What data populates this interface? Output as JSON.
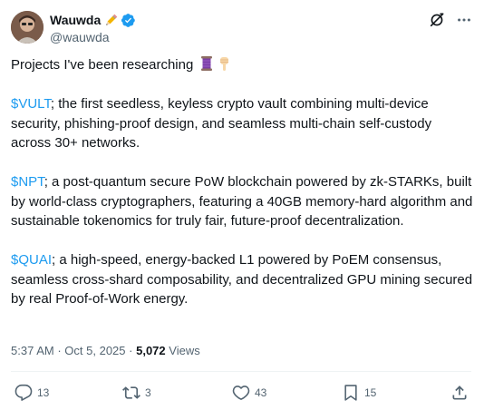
{
  "author": {
    "display_name": "Wauwda",
    "handle": "@wauwda"
  },
  "tweet": {
    "intro": "Projects I've been researching",
    "paragraphs": [
      {
        "cashtag": "$VULT",
        "text": "; the first seedless, keyless crypto vault combining multi-device security, phishing-proof design, and seamless multi-chain self-custody across 30+ networks."
      },
      {
        "cashtag": "$NPT",
        "text": "; a post-quantum secure PoW blockchain powered by zk-STARKs, built by world-class cryptographers, featuring a 40GB memory-hard algorithm and sustainable tokenomics for truly fair, future-proof decentralization."
      },
      {
        "cashtag": "$QUAI",
        "text": "; a high-speed, energy-backed L1 powered by PoEM consensus, seamless cross-shard composability, and decentralized GPU mining secured by real Proof-of-Work energy."
      }
    ]
  },
  "meta": {
    "time": "5:37 AM",
    "separator": "·",
    "date": "Oct 5, 2025",
    "views_count": "5,072",
    "views_label": "Views"
  },
  "actions": {
    "replies": "13",
    "reposts": "3",
    "likes": "43",
    "bookmarks": "15"
  },
  "icons": {
    "name_emoji": "pencil-emoji",
    "verified": "verified-badge-icon",
    "grok": "grok-icon",
    "more": "more-dots-icon",
    "intro_emoji_1": "thread-spool-emoji",
    "intro_emoji_2": "pointing-down-emoji",
    "reply": "reply-icon",
    "repost": "repost-icon",
    "like": "heart-icon",
    "bookmark": "bookmark-icon",
    "share": "share-icon"
  },
  "colors": {
    "text": "#0f1419",
    "secondary": "#536471",
    "accent": "#1d9bf0",
    "divider": "#eff3f4"
  }
}
